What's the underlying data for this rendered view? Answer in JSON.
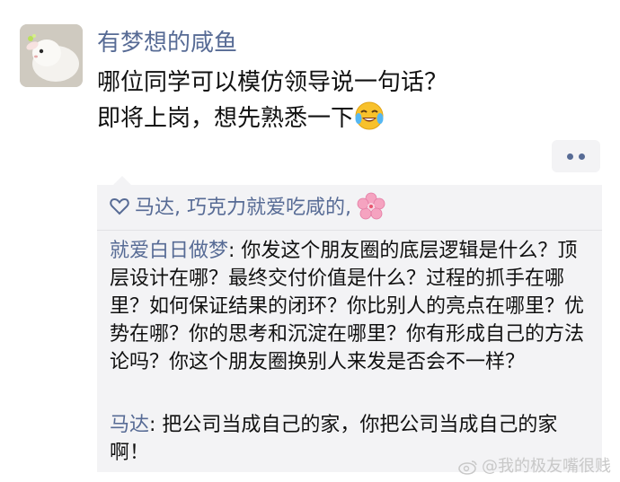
{
  "post": {
    "author": "有梦想的咸鱼",
    "text_line1": "哪位同学可以模仿领导说一句话？",
    "text_line2": "即将上岗，想先熟悉一下",
    "emoji": "crying-laughing-emoji"
  },
  "likes": {
    "names": "马达, 巧克力就爱吃咸的,",
    "icon": "heart-icon",
    "emoji": "cherry-blossom-emoji"
  },
  "comments": [
    {
      "name": "就爱白日做梦",
      "separator": ": ",
      "text": "你发这个朋友圈的底层逻辑是什么？顶层设计在哪？最终交付价值是什么？过程的抓手在哪里？如何保证结果的闭环？你比别人的亮点在哪里？优势在哪？你的思考和沉淀在哪里？你有形成自己的方法论吗？你这个朋友圈换别人来发是否会不一样？"
    },
    {
      "name": "马达",
      "separator": ": ",
      "text": "把公司当成自己的家，你把公司当成自己的家啊！"
    }
  ],
  "watermark": {
    "text": "@我的极友嘴很贱",
    "icon": "weibo-icon"
  },
  "colors": {
    "link": "#576b95",
    "comment_bg": "#f3f3f5"
  }
}
